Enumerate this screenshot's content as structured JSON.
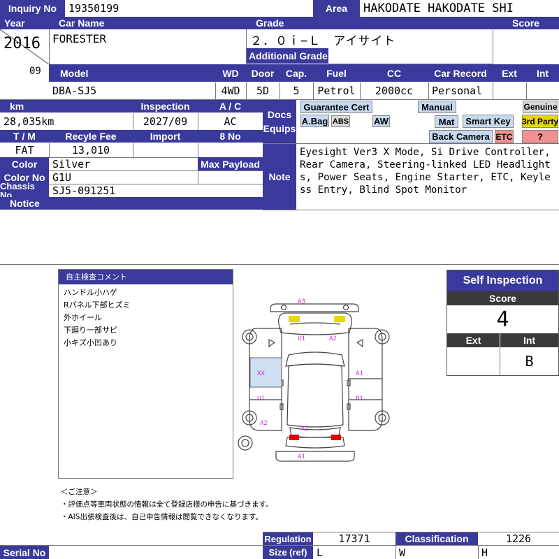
{
  "header": {
    "inquiry_label": "Inquiry No",
    "inquiry_value": "19350199",
    "area_label": "Area",
    "area_value": "HAKODATE HAKODATE SHI",
    "year_label": "Year",
    "year_value": "2016",
    "month_value": "09",
    "carname_label": "Car Name",
    "carname_value": "FORESTER",
    "grade_label": "Grade",
    "grade_value": "２．０ｉ−Ｌ　アイサイト",
    "additional_grade_label": "Additional Grade",
    "score_label": "Score"
  },
  "specs": {
    "model_label": "Model",
    "model_value": "DBA-SJ5",
    "wd_label": "WD",
    "wd_value": "4WD",
    "door_label": "Door",
    "door_value": "5D",
    "cap_label": "Cap.",
    "cap_value": "5",
    "fuel_label": "Fuel",
    "fuel_value": "Petrol",
    "cc_label": "CC",
    "cc_value": "2000cc",
    "record_label": "Car Record",
    "record_value": "Personal",
    "ext_label": "Ext",
    "int_label": "Int"
  },
  "details": {
    "km_label": "km",
    "km_value": "28,035km",
    "inspection_label": "Inspection",
    "inspection_value": "2027/09",
    "ac_label": "A / C",
    "ac_value": "AC",
    "tm_label": "T / M",
    "tm_value": "FAT",
    "recycle_label": "Recyle Fee",
    "recycle_value": "13,010",
    "import_label": "Import",
    "eightno_label": "8 No",
    "color_label": "Color",
    "color_value": "Silver",
    "maxpayload_label": "Max Payload",
    "colorno_label": "Color No",
    "colorno_value": "G1U",
    "chassis_label": "Chassis No",
    "chassis_value": "SJ5-091251",
    "notice_label": "Notice"
  },
  "equips": {
    "label_docs": "Docs",
    "label_equips": "Equips",
    "guarantee": "Guarantee Cert",
    "manual": "Manual",
    "genuine": "Genuine",
    "abag": "A.Bag",
    "abs": "ABS",
    "aw": "AW",
    "mat": "Mat",
    "smartkey": "Smart Key",
    "third_party": "3rd Party",
    "backcamera": "Back Camera",
    "etc": "ETC",
    "question": "?"
  },
  "note": {
    "label": "Note",
    "text": "Eyesight Ver3 X Mode, Si Drive Controller, Rear Camera, Steering-linked LED Headlights, Power Seats, Engine Starter, ETC, Keyless Entry, Blind Spot Monitor"
  },
  "self_comment": {
    "title": "自主検査コメント",
    "items": [
      "ハンドル小ハゲ",
      "Rパネル下部ヒズミ",
      "外ホイール",
      "下廻り一部サビ",
      "小キズ小凹あり"
    ]
  },
  "diagram": {
    "marks": {
      "a3": "A3",
      "u1_top": "U1",
      "a2_top": "A2",
      "xx": "XX",
      "a1_right": "A1",
      "u1_left": "U1",
      "b1_right": "B1",
      "a2_left": "A2",
      "a2_rear": "A2",
      "a1_bottom": "A1"
    },
    "colors": {
      "mark": "#cc33cc",
      "yellow": "#e8d800",
      "red": "#e00000",
      "blue_panel": "#cfe0f5"
    }
  },
  "notes_footer": {
    "title": "＜ご注意＞",
    "line1": "・評価点等車両状態の情報は全て登録店様の申告に基づきます。",
    "line2": "・AIS出張検査後は、自己申告情報は閲覧できなくなります。"
  },
  "self_inspection": {
    "title": "Self Inspection",
    "score_label": "Score",
    "score_value": "4",
    "ext_label": "Ext",
    "int_label": "Int",
    "ext_value": "",
    "int_value": "B"
  },
  "footer": {
    "regulation_label": "Regulation",
    "regulation_value": "17371",
    "classification_label": "Classification",
    "classification_value": "1226",
    "size_label": "Size (ref)",
    "size_l": "L",
    "size_w": "W",
    "size_h": "H",
    "serial_label": "Serial No"
  }
}
